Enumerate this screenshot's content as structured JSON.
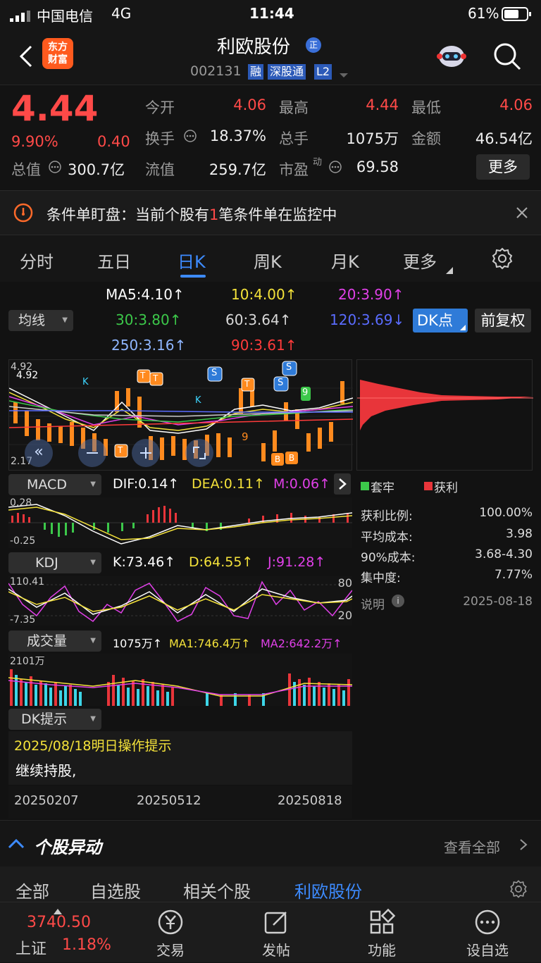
{
  "status_bar": {
    "carrier": "中国电信",
    "network": "4G",
    "time": "11:44",
    "battery": "61%"
  },
  "header": {
    "brand_line1": "东方",
    "brand_line2": "财富",
    "stock_name": "利欧股份",
    "name_badge": "正",
    "stock_code": "002131",
    "tags": [
      "融",
      "深股通",
      "L2"
    ]
  },
  "quote": {
    "price": "4.44",
    "change_pct": "9.90%",
    "change_abs": "0.40",
    "total_mv_label": "总值",
    "total_mv": "300.7亿",
    "stats": [
      {
        "label": "今开",
        "value": "4.06"
      },
      {
        "label": "最高",
        "value": "4.44"
      },
      {
        "label": "最低",
        "value": "4.06"
      },
      {
        "label": "换手",
        "value": "18.37%"
      },
      {
        "label": "总手",
        "value": "1075万"
      },
      {
        "label": "金额",
        "value": "46.54亿"
      },
      {
        "label": "流值",
        "value": "259.7亿"
      },
      {
        "label": "市盈",
        "sup": "动",
        "value": "69.58"
      }
    ],
    "more_button": "更多"
  },
  "alert": {
    "text_prefix": "条件单盯盘：当前个股有",
    "count": "1",
    "text_suffix": "笔条件单在监控中"
  },
  "tabs": [
    {
      "label": "分时"
    },
    {
      "label": "五日"
    },
    {
      "label": "日K"
    },
    {
      "label": "周K"
    },
    {
      "label": "月K"
    },
    {
      "label": "更多"
    }
  ],
  "ma_panel": {
    "selector": "均线",
    "items": [
      {
        "text": "MA5:4.10↑",
        "color": "#ffffff"
      },
      {
        "text": "10:4.00↑",
        "color": "#f4e23a"
      },
      {
        "text": "20:3.90↑",
        "color": "#e040e8"
      },
      {
        "text": "30:3.80↑",
        "color": "#3cc84a"
      },
      {
        "text": "60:3.64↑",
        "color": "#d8d8d8"
      },
      {
        "text": "120:3.69↓",
        "color": "#5a6cff"
      },
      {
        "text": "250:3.16↑",
        "color": "#8fb6ff"
      },
      {
        "text": "90:3.61↑",
        "color": "#ff3b3b"
      }
    ],
    "dk_button": "DK点",
    "adjust_button": "前复权"
  },
  "main_chart": {
    "y_top": "4.92",
    "y_top2": "4.92",
    "y_bottom": "2.17",
    "marker_s": "S",
    "marker_t": "T",
    "marker_b": "B",
    "marker_nine": "9",
    "marker_k": "K"
  },
  "macd": {
    "selector": "MACD",
    "dif": "DIF:0.14↑",
    "dea": "DEA:0.11↑",
    "m": "M:0.06↑",
    "y_top": "0.28",
    "y_bottom": "-0.25"
  },
  "kdj": {
    "selector": "KDJ",
    "k": "K:73.46↑",
    "d": "D:64.55↑",
    "j": "J:91.28↑",
    "y_top": "110.41",
    "y_bottom": "-7.35",
    "level_high": "80",
    "level_low": "20"
  },
  "volume": {
    "selector": "成交量",
    "vol": "1075万↑",
    "ma1": "MA1:746.4万↑",
    "ma2": "MA2:642.2万↑",
    "y_top": "2101万"
  },
  "dk_hint": {
    "selector": "DK提示",
    "title": "2025/08/18明日操作提示",
    "body": "继续持股,"
  },
  "dates": [
    "20250207",
    "20250512",
    "20250818"
  ],
  "chip": {
    "legend_trapped": "套牢",
    "legend_profit": "获利",
    "rows": [
      {
        "label": "获利比例:",
        "value": "100.00%"
      },
      {
        "label": "平均成本:",
        "value": "3.98"
      },
      {
        "label": "90%成本:",
        "value": "3.68-4.30"
      },
      {
        "label": "集中度:",
        "value": "7.77%"
      }
    ],
    "note_label": "说明",
    "note_date": "2025-08-18"
  },
  "movement": {
    "title": "个股异动",
    "view_all": "查看全部"
  },
  "sub_tabs": [
    "全部",
    "自选股",
    "相关个股",
    "利欧股份"
  ],
  "index": {
    "value": "3740.50",
    "name": "上证",
    "pct": "1.18%"
  },
  "bottom_nav": [
    {
      "label": "交易",
      "icon": "yen-circle-icon"
    },
    {
      "label": "发帖",
      "icon": "edit-icon"
    },
    {
      "label": "功能",
      "icon": "grid-icon"
    },
    {
      "label": "设自选",
      "icon": "more-circle-icon"
    }
  ],
  "colors": {
    "up": "#ff4a48",
    "accent": "#2f7bd8",
    "bg": "#121212"
  }
}
